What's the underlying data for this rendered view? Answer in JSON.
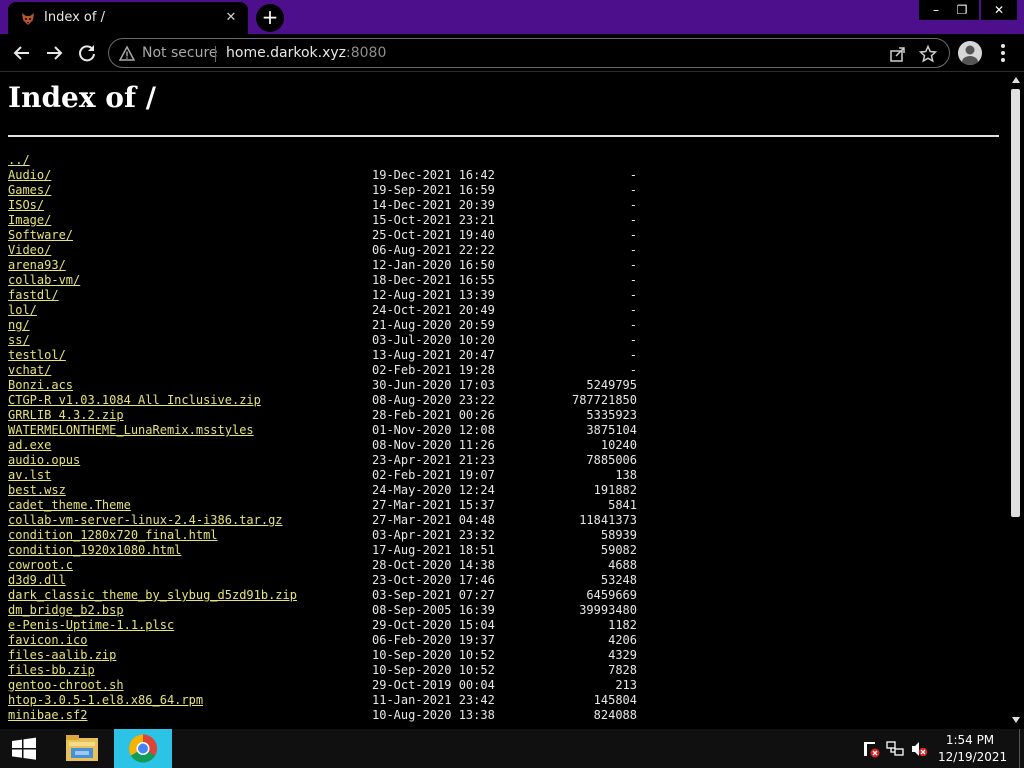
{
  "browser": {
    "tab_title": "Index of /",
    "tab_close": "✕",
    "new_tab": "+",
    "window_controls": {
      "minimize": "–",
      "maximize": "❐",
      "close": "✕"
    },
    "security_label": "Not secure",
    "url_host": "home.darkok.xyz",
    "url_port": ":8080"
  },
  "page": {
    "title": "Index of /",
    "parent_link": "../",
    "entries": [
      {
        "name": "Audio/",
        "date": "19-Dec-2021 16:42",
        "size": "-"
      },
      {
        "name": "Games/",
        "date": "19-Sep-2021 16:59",
        "size": "-"
      },
      {
        "name": "ISOs/",
        "date": "14-Dec-2021 20:39",
        "size": "-"
      },
      {
        "name": "Image/",
        "date": "15-Oct-2021 23:21",
        "size": "-"
      },
      {
        "name": "Software/",
        "date": "25-Oct-2021 19:40",
        "size": "-"
      },
      {
        "name": "Video/",
        "date": "06-Aug-2021 22:22",
        "size": "-"
      },
      {
        "name": "arena93/",
        "date": "12-Jan-2020 16:50",
        "size": "-"
      },
      {
        "name": "collab-vm/",
        "date": "18-Dec-2021 16:55",
        "size": "-"
      },
      {
        "name": "fastdl/",
        "date": "12-Aug-2021 13:39",
        "size": "-"
      },
      {
        "name": "lol/",
        "date": "24-Oct-2021 20:49",
        "size": "-"
      },
      {
        "name": "ng/",
        "date": "21-Aug-2020 20:59",
        "size": "-"
      },
      {
        "name": "ss/",
        "date": "03-Jul-2020 10:20",
        "size": "-"
      },
      {
        "name": "testlol/",
        "date": "13-Aug-2021 20:47",
        "size": "-"
      },
      {
        "name": "vchat/",
        "date": "02-Feb-2021 19:28",
        "size": "-"
      },
      {
        "name": "Bonzi.acs",
        "date": "30-Jun-2020 17:03",
        "size": "5249795"
      },
      {
        "name": "CTGP-R v1.03.1084 All Inclusive.zip",
        "date": "08-Aug-2020 23:22",
        "size": "787721850"
      },
      {
        "name": "GRRLIB 4.3.2.zip",
        "date": "28-Feb-2021 00:26",
        "size": "5335923"
      },
      {
        "name": "WATERMELONTHEME_LunaRemix.msstyles",
        "date": "01-Nov-2020 12:08",
        "size": "3875104"
      },
      {
        "name": "ad.exe",
        "date": "08-Nov-2020 11:26",
        "size": "10240"
      },
      {
        "name": "audio.opus",
        "date": "23-Apr-2021 21:23",
        "size": "7885006"
      },
      {
        "name": "av.lst",
        "date": "02-Feb-2021 19:07",
        "size": "138"
      },
      {
        "name": "best.wsz",
        "date": "24-May-2020 12:24",
        "size": "191882"
      },
      {
        "name": "cadet_theme.Theme",
        "date": "27-Mar-2021 15:37",
        "size": "5841"
      },
      {
        "name": "collab-vm-server-linux-2.4-i386.tar.gz",
        "date": "27-Mar-2021 04:48",
        "size": "11841373"
      },
      {
        "name": "condition_1280x720_final.html",
        "date": "03-Apr-2021 23:32",
        "size": "58939"
      },
      {
        "name": "condition_1920x1080.html",
        "date": "17-Aug-2021 18:51",
        "size": "59082"
      },
      {
        "name": "cowroot.c",
        "date": "28-Oct-2020 14:38",
        "size": "4688"
      },
      {
        "name": "d3d9.dll",
        "date": "23-Oct-2020 17:46",
        "size": "53248"
      },
      {
        "name": "dark_classic_theme_by_slybug_d5zd91b.zip",
        "date": "03-Sep-2021 07:27",
        "size": "6459669"
      },
      {
        "name": "dm_bridge_b2.bsp",
        "date": "08-Sep-2005 16:39",
        "size": "39993480"
      },
      {
        "name": "e-Penis-Uptime-1.1.plsc",
        "date": "29-Oct-2020 15:04",
        "size": "1182"
      },
      {
        "name": "favicon.ico",
        "date": "06-Feb-2020 19:37",
        "size": "4206"
      },
      {
        "name": "files-aalib.zip",
        "date": "10-Sep-2020 10:52",
        "size": "4329"
      },
      {
        "name": "files-bb.zip",
        "date": "10-Sep-2020 10:52",
        "size": "7828"
      },
      {
        "name": "gentoo-chroot.sh",
        "date": "29-Oct-2019 00:04",
        "size": "213"
      },
      {
        "name": "htop-3.0.5-1.el8.x86_64.rpm",
        "date": "11-Jan-2021 23:42",
        "size": "145804"
      },
      {
        "name": "minibae.sf2",
        "date": "10-Aug-2020 13:38",
        "size": "824088"
      }
    ]
  },
  "taskbar": {
    "time": "1:54 PM",
    "date": "12/19/2021"
  },
  "colors": {
    "titlebar": "#4e0f8c",
    "link": "#e6e37a",
    "chrome_button_bg": "#2bc3e6"
  }
}
